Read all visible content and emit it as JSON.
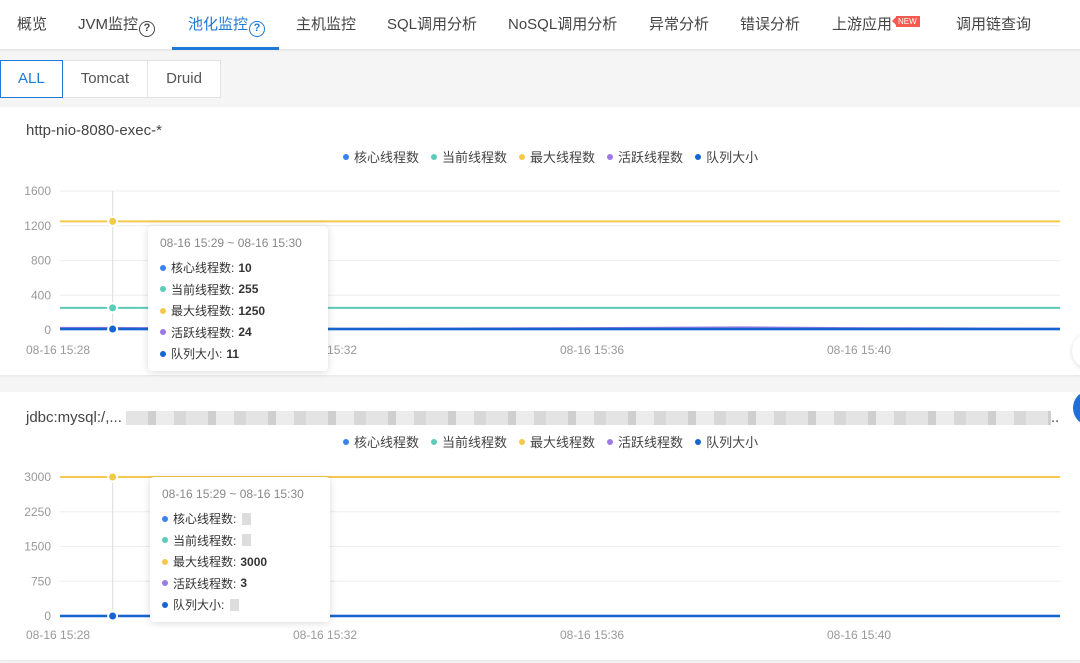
{
  "topnav": {
    "tabs": [
      {
        "label": "概览"
      },
      {
        "label": "JVM监控",
        "help": "?"
      },
      {
        "label": "池化监控",
        "help": "?",
        "active": true
      },
      {
        "label": "主机监控"
      },
      {
        "label": "SQL调用分析"
      },
      {
        "label": "NoSQL调用分析"
      },
      {
        "label": "异常分析"
      },
      {
        "label": "错误分析"
      },
      {
        "label": "上游应用",
        "badge": "NEW"
      },
      {
        "label": "调用链查询"
      }
    ]
  },
  "subtabs": [
    {
      "label": "ALL",
      "active": true
    },
    {
      "label": "Tomcat"
    },
    {
      "label": "Druid"
    }
  ],
  "colors": {
    "accent": "#1e7ad6",
    "badge": "#f25b4e",
    "core_threads": "#3b82f0",
    "current_threads": "#5ecbb8",
    "max_threads": "#f5c84c",
    "active_threads": "#9b7ae6",
    "queue_size": "#1565d0"
  },
  "legend": [
    {
      "label": "核心线程数",
      "key": "core_threads"
    },
    {
      "label": "当前线程数",
      "key": "current_threads"
    },
    {
      "label": "最大线程数",
      "key": "max_threads"
    },
    {
      "label": "活跃线程数",
      "key": "active_threads"
    },
    {
      "label": "队列大小",
      "key": "queue_size"
    }
  ],
  "panels": [
    {
      "title": "http-nio-8080-exec-*",
      "chart_data": {
        "type": "line",
        "title": "http-nio-8080-exec-*",
        "x_ticks": [
          "08-16 15:28",
          "08-16 15:32",
          "08-16 15:36",
          "08-16 15:40"
        ],
        "y_ticks": [
          "0",
          "400",
          "800",
          "1200",
          "1600"
        ],
        "ylim": [
          0,
          1600
        ],
        "grid": true,
        "legend_position": "top-center",
        "series": [
          {
            "name": "核心线程数",
            "key": "core_threads",
            "values": [
              10,
              10,
              10,
              10,
              10,
              10,
              10,
              10,
              10,
              10,
              10,
              10,
              10,
              10,
              10,
              10,
              10,
              10,
              10,
              10
            ]
          },
          {
            "name": "当前线程数",
            "key": "current_threads",
            "values": [
              255,
              255,
              255,
              255,
              255,
              255,
              255,
              255,
              255,
              255,
              255,
              255,
              255,
              255,
              255,
              255,
              255,
              255,
              255,
              255
            ]
          },
          {
            "name": "最大线程数",
            "key": "max_threads",
            "values": [
              1250,
              1250,
              1250,
              1250,
              1250,
              1250,
              1250,
              1250,
              1250,
              1250,
              1250,
              1250,
              1250,
              1250,
              1250,
              1250,
              1250,
              1250,
              1250,
              1250
            ]
          },
          {
            "name": "活跃线程数",
            "key": "active_threads",
            "values": [
              24,
              24,
              20,
              18,
              16,
              14,
              14,
              16,
              18,
              20,
              22,
              24,
              28,
              30,
              26,
              22,
              20,
              18,
              16,
              14
            ]
          },
          {
            "name": "队列大小",
            "key": "queue_size",
            "values": [
              11,
              11,
              11,
              11,
              11,
              11,
              11,
              11,
              11,
              11,
              11,
              11,
              11,
              11,
              11,
              11,
              11,
              11,
              11,
              11
            ]
          }
        ],
        "tooltip": {
          "title": "08-16 15:29 ~ 08-16 15:30",
          "rows": [
            {
              "label": "核心线程数:",
              "key": "core_threads",
              "value": "10"
            },
            {
              "label": "当前线程数:",
              "key": "current_threads",
              "value": "255"
            },
            {
              "label": "最大线程数:",
              "key": "max_threads",
              "value": "1250"
            },
            {
              "label": "活跃线程数:",
              "key": "active_threads",
              "value": "24"
            },
            {
              "label": "队列大小:",
              "key": "queue_size",
              "value": "11"
            }
          ]
        }
      }
    },
    {
      "title": "jdbc:mysql:/,...",
      "title_suffix": "..",
      "chart_data": {
        "type": "line",
        "title": "jdbc:mysql:/,...",
        "x_ticks": [
          "08-16 15:28",
          "08-16 15:32",
          "08-16 15:36",
          "08-16 15:40"
        ],
        "y_ticks": [
          "0",
          "750",
          "1500",
          "2250",
          "3000"
        ],
        "ylim": [
          0,
          3000
        ],
        "grid": true,
        "legend_position": "top-center",
        "series": [
          {
            "name": "核心线程数",
            "key": "core_threads",
            "values": [
              0,
              0,
              0,
              0,
              0,
              0,
              0,
              0,
              0,
              0,
              0,
              0,
              0,
              0,
              0,
              0,
              0,
              0,
              0,
              0
            ]
          },
          {
            "name": "当前线程数",
            "key": "current_threads",
            "values": [
              0,
              0,
              0,
              0,
              0,
              0,
              0,
              0,
              0,
              0,
              0,
              0,
              0,
              0,
              0,
              0,
              0,
              0,
              0,
              0
            ]
          },
          {
            "name": "最大线程数",
            "key": "max_threads",
            "values": [
              3000,
              3000,
              3000,
              3000,
              3000,
              3000,
              3000,
              3000,
              3000,
              3000,
              3000,
              3000,
              3000,
              3000,
              3000,
              3000,
              3000,
              3000,
              3000,
              3000
            ]
          },
          {
            "name": "活跃线程数",
            "key": "active_threads",
            "values": [
              3,
              3,
              3,
              3,
              3,
              3,
              3,
              3,
              3,
              3,
              3,
              3,
              3,
              3,
              3,
              3,
              3,
              3,
              3,
              3
            ]
          },
          {
            "name": "队列大小",
            "key": "queue_size",
            "values": [
              0,
              0,
              0,
              0,
              0,
              0,
              0,
              0,
              0,
              0,
              0,
              0,
              0,
              0,
              0,
              0,
              0,
              0,
              0,
              0
            ]
          }
        ],
        "tooltip": {
          "title": "08-16 15:29 ~ 08-16 15:30",
          "rows": [
            {
              "label": "核心线程数:",
              "key": "core_threads",
              "value": null
            },
            {
              "label": "当前线程数:",
              "key": "current_threads",
              "value": null
            },
            {
              "label": "最大线程数:",
              "key": "max_threads",
              "value": "3000"
            },
            {
              "label": "活跃线程数:",
              "key": "active_threads",
              "value": "3"
            },
            {
              "label": "队列大小:",
              "key": "queue_size",
              "value": null
            }
          ]
        }
      }
    }
  ]
}
